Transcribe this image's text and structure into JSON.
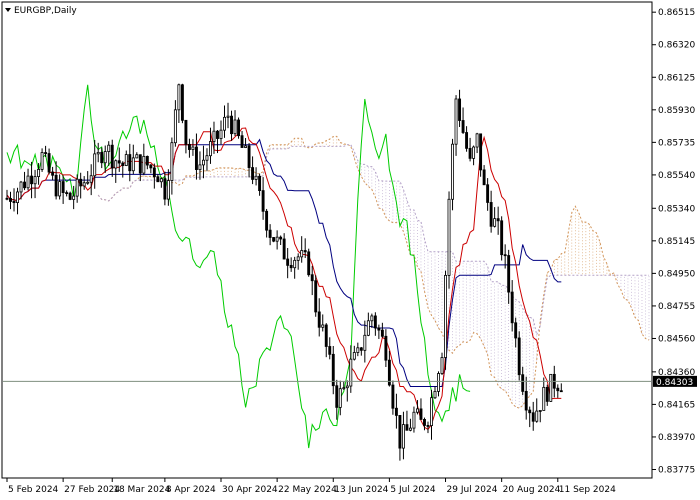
{
  "window": {
    "symbol_title": "EURGBP,Daily",
    "menu_icon": "triangle-down-icon"
  },
  "colors": {
    "background": "#ffffff",
    "frame": "#000000",
    "candle": "#000000",
    "tenkan": "#cc0000",
    "kijun": "#000080",
    "chikou": "#00cc00",
    "senkou_a": "#d2955a",
    "senkou_b": "#b4a2c8",
    "current_price_line": "#7f8f7f",
    "current_price_tag": "#000000"
  },
  "chart_data": {
    "type": "candlestick",
    "title": "EURGBP,Daily",
    "y_ticks": [
      "0.86515",
      "0.86320",
      "0.86125",
      "0.85930",
      "0.85735",
      "0.85540",
      "0.85340",
      "0.85145",
      "0.84950",
      "0.84755",
      "0.84560",
      "0.84360",
      "0.84165",
      "0.83970",
      "0.83775"
    ],
    "ylim": [
      0.8373,
      0.8657
    ],
    "x_ticks": [
      {
        "label": "5 Feb 2024",
        "index": 0
      },
      {
        "label": "27 Feb 2024",
        "index": 16
      },
      {
        "label": "18 Mar 2024",
        "index": 30
      },
      {
        "label": "8 Apr 2024",
        "index": 45
      },
      {
        "label": "30 Apr 2024",
        "index": 61
      },
      {
        "label": "22 May 2024",
        "index": 77
      },
      {
        "label": "13 Jun 2024",
        "index": 93
      },
      {
        "label": "5 Jul 2024",
        "index": 109
      },
      {
        "label": "29 Jul 2024",
        "index": 125
      },
      {
        "label": "20 Aug 2024",
        "index": 141
      },
      {
        "label": "11 Sep 2024",
        "index": 157
      }
    ],
    "current_price": "0.84303",
    "series": [
      {
        "name": "price",
        "kind": "ohlc",
        "ohlc": []
      },
      {
        "name": "tenkan",
        "kind": "line",
        "values": []
      },
      {
        "name": "kijun",
        "kind": "line",
        "values": []
      },
      {
        "name": "chikou",
        "kind": "line",
        "values": []
      },
      {
        "name": "senkou_a",
        "kind": "cloud-edge",
        "values": []
      },
      {
        "name": "senkou_b",
        "kind": "cloud-edge",
        "values": []
      }
    ]
  }
}
